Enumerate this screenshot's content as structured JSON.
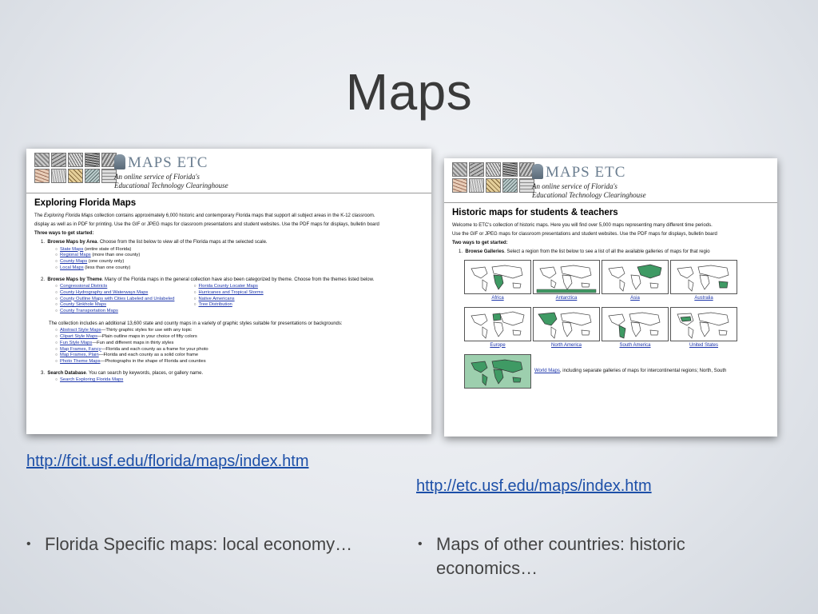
{
  "slide": {
    "title": "Maps",
    "left": {
      "url": "http://fcit.usf.edu/florida/maps/index.htm",
      "bullet": "Florida Specific maps: local economy…"
    },
    "right": {
      "url": "http://etc.usf.edu/maps/index.htm",
      "bullet": "Maps of other countries: historic economics…"
    }
  },
  "brand": {
    "logo": "MAPS ETC",
    "tagline_1": "An online service of Florida's",
    "tagline_2": "Educational Technology Clearinghouse"
  },
  "left_page": {
    "heading": "Exploring Florida Maps",
    "intro_1a": "The ",
    "intro_1b": "Exploring Florida Maps",
    "intro_1c": " collection contains approximately 6,000 historic and contemporary Florida maps that support all subject areas in the K-12 classroom.",
    "intro_2": "display as well as in PDF for printing. Use the GIF or JPEG maps for classroom presentations and student websites. Use the PDF maps for displays, bulletin board",
    "three_ways": "Three ways to get started:",
    "s1_num": "1.",
    "s1_bold": "Browse Maps by Area",
    "s1_text": ". Choose from the list below to view all of the Florida maps at the selected scale.",
    "area": [
      {
        "link": "State Maps",
        "note": " (entire state of Florida)"
      },
      {
        "link": "Regional Maps",
        "note": " (more than one county)"
      },
      {
        "link": "County Maps",
        "note": " (one county only)"
      },
      {
        "link": "Local Maps",
        "note": " (less than one county)"
      }
    ],
    "s2_num": "2.",
    "s2_bold": "Browse Maps by Theme",
    "s2_text": ". Many of the Florida maps in the general collection have also been categorized by theme. Choose from the themes listed below.",
    "theme_col1": [
      "Congressional Districts",
      "County Hydrography and Waterways Maps",
      "County Outline Maps with Cities Labeled and Unlabeled",
      "County Sinkhole Maps",
      "County Transportation Maps"
    ],
    "theme_col2": [
      "Florida County Locater Maps",
      "Hurricanes and Tropical Storms",
      "Native Americans",
      "Tree Distribution"
    ],
    "collection_text": "The collection includes an additional 13,600 state and county maps in a variety of graphic styles suitable for presentations or backgrounds:",
    "styles": [
      {
        "link": "Abstract Style Maps",
        "note": "—Thirty graphic styles for use with any topic"
      },
      {
        "link": "Clipart Style Maps",
        "note": "—Plain outline maps in your choice of fifty colors"
      },
      {
        "link": "Fun Style Maps",
        "note": "—Fun and different maps in thirty styles"
      },
      {
        "link": "Map Frames, Fancy",
        "note": "—Florida and each county as a frame for your photo"
      },
      {
        "link": "Map Frames, Plain",
        "note": "—Florida and each county as a solid color frame"
      },
      {
        "link": "Photo Theme Maps",
        "note": "—Photographs in the shape of Florida and counties"
      }
    ],
    "s3_num": "3.",
    "s3_bold": "Search Database",
    "s3_text": ". You can search by keywords, places, or gallery name.",
    "search_link": "Search Exploring Florida Maps"
  },
  "right_page": {
    "heading": "Historic maps for students & teachers",
    "intro_1": "Welcome to ETC's collection of historic maps. Here you will find over 5,000 maps representing many different time periods.",
    "intro_2": "Use the GIF or JPEG maps for classroom presentations and student websites. Use the PDF maps for displays, bulletin board",
    "two_ways": "Two ways to get started:",
    "s1_num": "1.",
    "s1_bold": "Browse Galleries",
    "s1_text": ". Select a region from the list below to see a list of all the available galleries of maps for that regio",
    "galleries_row1": [
      "Africa",
      "Antarctica",
      "Asia",
      "Australia"
    ],
    "galleries_row2": [
      "Europe",
      "North America",
      "South America",
      "United States"
    ],
    "world_link": "World Maps",
    "world_text": ", including separate galleries of maps for intercontinental regions; North, South"
  },
  "colors": {
    "link": "#1a33aa",
    "slide_link": "#1c4fa8",
    "map_highlight": "#3f9a64"
  }
}
